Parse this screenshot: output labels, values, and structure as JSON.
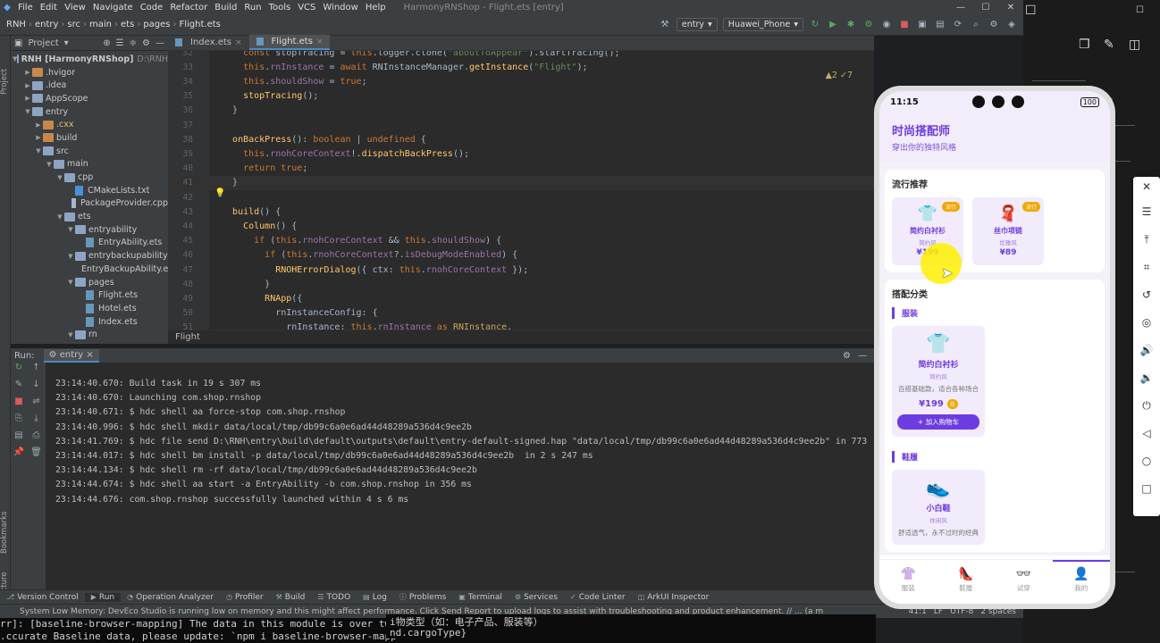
{
  "menubar": {
    "items": [
      "File",
      "Edit",
      "View",
      "Navigate",
      "Code",
      "Refactor",
      "Build",
      "Run",
      "Tools",
      "VCS",
      "Window",
      "Help"
    ],
    "window_title": "HarmonyRNShop - Flight.ets [entry]"
  },
  "toolbar": {
    "breadcrumbs": [
      "RNH",
      "entry",
      "src",
      "main",
      "ets",
      "pages",
      "Flight.ets"
    ],
    "module": "entry",
    "device": "Huawei_Phone"
  },
  "project": {
    "label": "Project",
    "tree": [
      {
        "depth": 0,
        "open": true,
        "icon": "folder",
        "label": "RNH [HarmonyRNShop]",
        "suffix": "D:\\RNH"
      },
      {
        "depth": 1,
        "open": false,
        "icon": "folder-orange",
        "label": ".hvigor"
      },
      {
        "depth": 1,
        "open": false,
        "icon": "folder",
        "label": ".idea"
      },
      {
        "depth": 1,
        "open": false,
        "icon": "folder",
        "label": "AppScope"
      },
      {
        "depth": 1,
        "open": true,
        "icon": "folder",
        "label": "entry"
      },
      {
        "depth": 2,
        "open": false,
        "icon": "folder-orange",
        "label": ".cxx",
        "hl": true
      },
      {
        "depth": 2,
        "open": false,
        "icon": "folder-orange",
        "label": "build"
      },
      {
        "depth": 2,
        "open": true,
        "icon": "folder",
        "label": "src"
      },
      {
        "depth": 3,
        "open": true,
        "icon": "folder",
        "label": "main"
      },
      {
        "depth": 4,
        "open": true,
        "icon": "folder",
        "label": "cpp"
      },
      {
        "depth": 5,
        "open": null,
        "icon": "cm",
        "label": "CMakeLists.txt"
      },
      {
        "depth": 5,
        "open": null,
        "icon": "file",
        "label": "PackageProvider.cpp"
      },
      {
        "depth": 4,
        "open": true,
        "icon": "folder",
        "label": "ets"
      },
      {
        "depth": 5,
        "open": true,
        "icon": "folder",
        "label": "entryability"
      },
      {
        "depth": 6,
        "open": null,
        "icon": "ets",
        "label": "EntryAbility.ets"
      },
      {
        "depth": 5,
        "open": true,
        "icon": "folder",
        "label": "entrybackupability"
      },
      {
        "depth": 6,
        "open": null,
        "icon": "ets",
        "label": "EntryBackupAbility.ets"
      },
      {
        "depth": 5,
        "open": true,
        "icon": "folder",
        "label": "pages"
      },
      {
        "depth": 6,
        "open": null,
        "icon": "ets",
        "label": "Flight.ets"
      },
      {
        "depth": 6,
        "open": null,
        "icon": "ets",
        "label": "Hotel.ets"
      },
      {
        "depth": 6,
        "open": null,
        "icon": "ets",
        "label": "Index.ets"
      },
      {
        "depth": 5,
        "open": true,
        "icon": "folder",
        "label": "rn"
      }
    ]
  },
  "editor": {
    "tabs": [
      {
        "label": "Index.ets",
        "active": false
      },
      {
        "label": "Flight.ets",
        "active": true
      }
    ],
    "warnings": "▲2 ✓7",
    "breadcrumb": "Flight",
    "lines": [
      {
        "n": "32",
        "html": "    <span class='kw'>const</span> stopTracing = <span class='kw'>this</span>.logger.clone(<span class='st'>\"aboutToAppear\"</span>).startTracing();"
      },
      {
        "n": "33",
        "html": "    <span class='kw'>this</span>.<span class='pr'>rnInstance</span> = <span class='kw'>await</span> RNInstanceManager.<span class='fn'>getInstance</span>(<span class='st'>\"Flight\"</span>);"
      },
      {
        "n": "34",
        "html": "    <span class='kw'>this</span>.<span class='pr'>shouldShow</span> = <span class='kw'>true</span>;"
      },
      {
        "n": "35",
        "html": "    <span class='fn'>stopTracing</span>();"
      },
      {
        "n": "36",
        "html": "  }"
      },
      {
        "n": "37",
        "html": ""
      },
      {
        "n": "38",
        "html": "  <span class='fn'>onBackPress</span>(): <span class='kw'>boolean</span> | <span class='kw'>undefined</span> {"
      },
      {
        "n": "39",
        "html": "    <span class='kw'>this</span>.<span class='pr'>rnohCoreContext</span>!.<span class='fn'>dispatchBackPress</span>();"
      },
      {
        "n": "40",
        "html": "    <span class='kw'>return true</span>;"
      },
      {
        "n": "41",
        "html": "  }"
      },
      {
        "n": "42",
        "html": ""
      },
      {
        "n": "43",
        "html": "  <span class='fn'>build</span>() {"
      },
      {
        "n": "44",
        "html": "    <span class='fn'>Column</span>() {"
      },
      {
        "n": "45",
        "html": "      <span class='kw'>if</span> (<span class='kw'>this</span>.<span class='pr'>rnohCoreContext</span> &amp;&amp; <span class='kw'>this</span>.<span class='pr'>shouldShow</span>) {"
      },
      {
        "n": "46",
        "html": "        <span class='kw'>if</span> (<span class='kw'>this</span>.<span class='pr'>rnohCoreContext</span>?.<span class='pr'>isDebugModeEnabled</span>) {"
      },
      {
        "n": "47",
        "html": "          <span class='fn'>RNOHErrorDialog</span>({ ctx: <span class='kw'>this</span>.<span class='pr'>rnohCoreContext</span> });"
      },
      {
        "n": "48",
        "html": "        }"
      },
      {
        "n": "49",
        "html": "        <span class='fn'>RNApp</span>({"
      },
      {
        "n": "50",
        "html": "          rnInstanceConfig: {"
      },
      {
        "n": "51",
        "html": "            rnInstance: <span class='kw'>this</span>.<span class='pr'>rnInstance</span> <span class='kw'>as</span> <span class='ty'>RNInstance</span>,"
      }
    ]
  },
  "run": {
    "label": "Run:",
    "config": "entry",
    "lines": [
      "23:14:40.670: Build task in 19 s 307 ms",
      "23:14:40.670: Launching com.shop.rnshop",
      "23:14:40.671: $ hdc shell aa force-stop com.shop.rnshop",
      "23:14:40.996: $ hdc shell mkdir data/local/tmp/db99c6a0e6ad44d48289a536d4c9ee2b",
      "23:14:41.769: $ hdc file send D:\\RNH\\entry\\build\\default\\outputs\\default\\entry-default-signed.hap \"data/local/tmp/db99c6a0e6ad44d48289a536d4c9ee2b\" in 773",
      "23:14:44.017: $ hdc shell bm install -p data/local/tmp/db99c6a0e6ad44d48289a536d4c9ee2b  in 2 s 247 ms",
      "23:14:44.134: $ hdc shell rm -rf data/local/tmp/db99c6a0e6ad44d48289a536d4c9ee2b",
      "23:14:44.674: $ hdc shell aa start -a EntryAbility -b com.shop.rnshop in 356 ms",
      "23:14:44.676: com.shop.rnshop successfully launched within 4 s 6 ms"
    ]
  },
  "tooltabs": [
    "Version Control",
    "Run",
    "Operation Analyzer",
    "Profiler",
    "Build",
    "TODO",
    "Log",
    "Problems",
    "Terminal",
    "Services",
    "Code Linter",
    "ArkUI Inspector"
  ],
  "statusbar": {
    "message": "System Low Memory: DevEco Studio is running low on memory and this might affect performance. Click Send Report to upload logs to assist with troubleshooting and product enhancement. // ... (a minute ago)",
    "pos": "41:1",
    "eol": "LF",
    "enc": "UTF-8",
    "indent": "2 spaces"
  },
  "terminal": {
    "line1": "rr]: [baseline-browser-mapping] The data in this module is over two mont",
    "line2": ".ccurate Baseline data, please update: `npm i baseline-browser-mapp",
    "overlay1": "i物类型（如：电子产品、服装等）",
    "overlay2": "nd.cargoType}"
  },
  "phone": {
    "time": "11:15",
    "battery": "100",
    "app_title": "时尚搭配师",
    "app_subtitle": "穿出你的独特风格",
    "trend_title": "流行推荐",
    "trend_items": [
      {
        "name": "简约白衬衫",
        "style": "简约风",
        "price": "¥199",
        "badge": "流行",
        "icon": "shirt-icon",
        "emoji": "👕"
      },
      {
        "name": "丝巾项链",
        "style": "优雅风",
        "price": "¥89",
        "badge": "流行",
        "icon": "scarf-icon",
        "emoji": "🧣"
      }
    ],
    "category_title": "搭配分类",
    "categories": [
      {
        "name": "服装",
        "product": {
          "name": "简约白衬衫",
          "style": "简约风",
          "desc": "百搭基础款，适合各种场合",
          "price": "¥199",
          "hot": "热",
          "add": "+ 加入购物车",
          "emoji": "👕"
        }
      },
      {
        "name": "鞋履",
        "product": {
          "name": "小白鞋",
          "style": "休闲风",
          "desc": "舒适透气，永不过时的经典",
          "emoji": "👟"
        }
      }
    ],
    "nav": [
      {
        "label": "服装",
        "emoji": "👚",
        "active": false
      },
      {
        "label": "鞋履",
        "emoji": "👠",
        "active": false
      },
      {
        "label": "试穿",
        "emoji": "👓",
        "active": false
      },
      {
        "label": "我的",
        "emoji": "👤",
        "active": true
      }
    ]
  }
}
